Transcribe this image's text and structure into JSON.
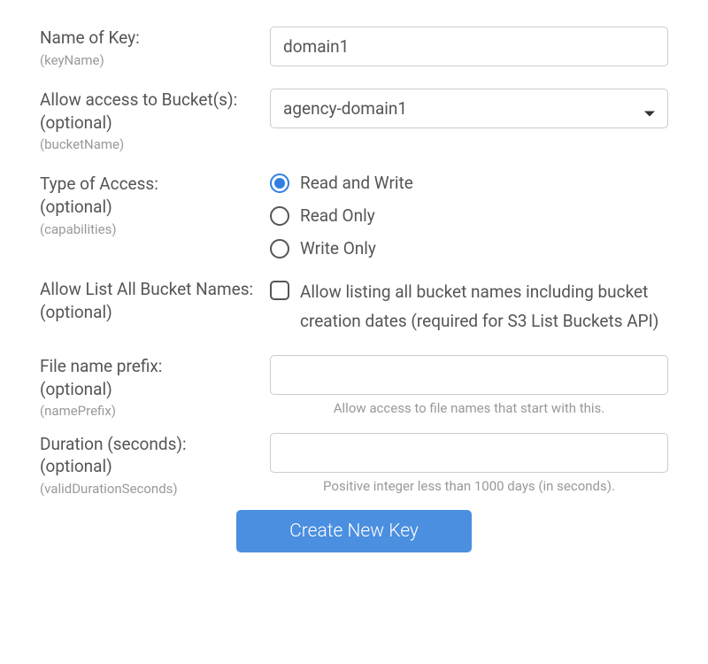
{
  "fields": {
    "keyName": {
      "label": "Name of Key:",
      "api": "(keyName)",
      "value": "domain1"
    },
    "bucketAccess": {
      "label": "Allow access to Bucket(s):",
      "optional": "(optional)",
      "api": "(bucketName)",
      "value": "agency-domain1"
    },
    "accessType": {
      "label": "Type of Access:",
      "optional": "(optional)",
      "api": "(capabilities)",
      "options": [
        {
          "label": "Read and Write",
          "selected": true
        },
        {
          "label": "Read Only",
          "selected": false
        },
        {
          "label": "Write Only",
          "selected": false
        }
      ]
    },
    "allowListAll": {
      "label": "Allow List All Bucket Names:",
      "optional": "(optional)",
      "checkbox_label": "Allow listing all bucket names including bucket creation dates (required for S3 List Buckets API)"
    },
    "namePrefix": {
      "label": "File name prefix:",
      "optional": "(optional)",
      "api": "(namePrefix)",
      "value": "",
      "hint": "Allow access to file names that start with this."
    },
    "duration": {
      "label": "Duration (seconds):",
      "optional": "(optional)",
      "api": "(validDurationSeconds)",
      "value": "",
      "hint": "Positive integer less than 1000 days (in seconds)."
    }
  },
  "button": {
    "create": "Create New Key"
  }
}
